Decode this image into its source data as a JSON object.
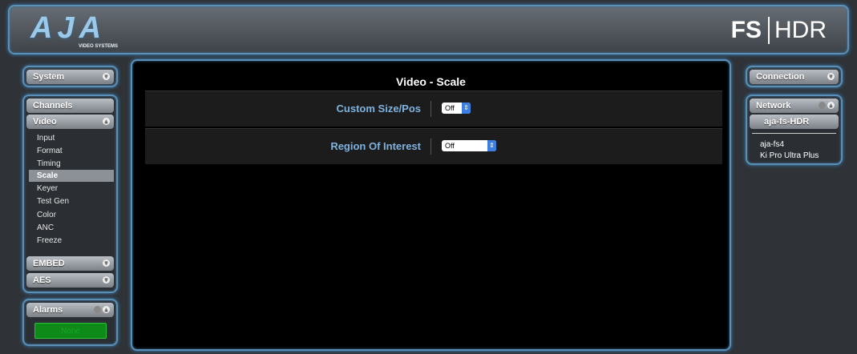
{
  "header": {
    "brand": "AJA",
    "brand_sub": "VIDEO SYSTEMS",
    "product_left": "FS",
    "product_right": "HDR"
  },
  "left": {
    "system": "System",
    "channels": "Channels",
    "video": "Video",
    "video_items": [
      "Input",
      "Format",
      "Timing",
      "Scale",
      "Keyer",
      "Test Gen",
      "Color",
      "ANC",
      "Freeze"
    ],
    "selected_item": "Scale",
    "embed": "EMBED",
    "aes": "AES",
    "alarms": "Alarms",
    "alarm_status": "None"
  },
  "main": {
    "title": "Video - Scale",
    "rows": [
      {
        "label": "Custom Size/Pos",
        "value": "Off"
      },
      {
        "label": "Region Of Interest",
        "value": "Off"
      }
    ]
  },
  "right": {
    "connection": "Connection",
    "network": "Network",
    "current_host": "aja-fs-HDR",
    "hosts": [
      "aja-fs4",
      "Ki Pro Ultra Plus"
    ]
  },
  "colors": {
    "accent_border": "#5b8fb5",
    "label_blue": "#7fb2df",
    "alarm_green": "#0d8a17"
  }
}
